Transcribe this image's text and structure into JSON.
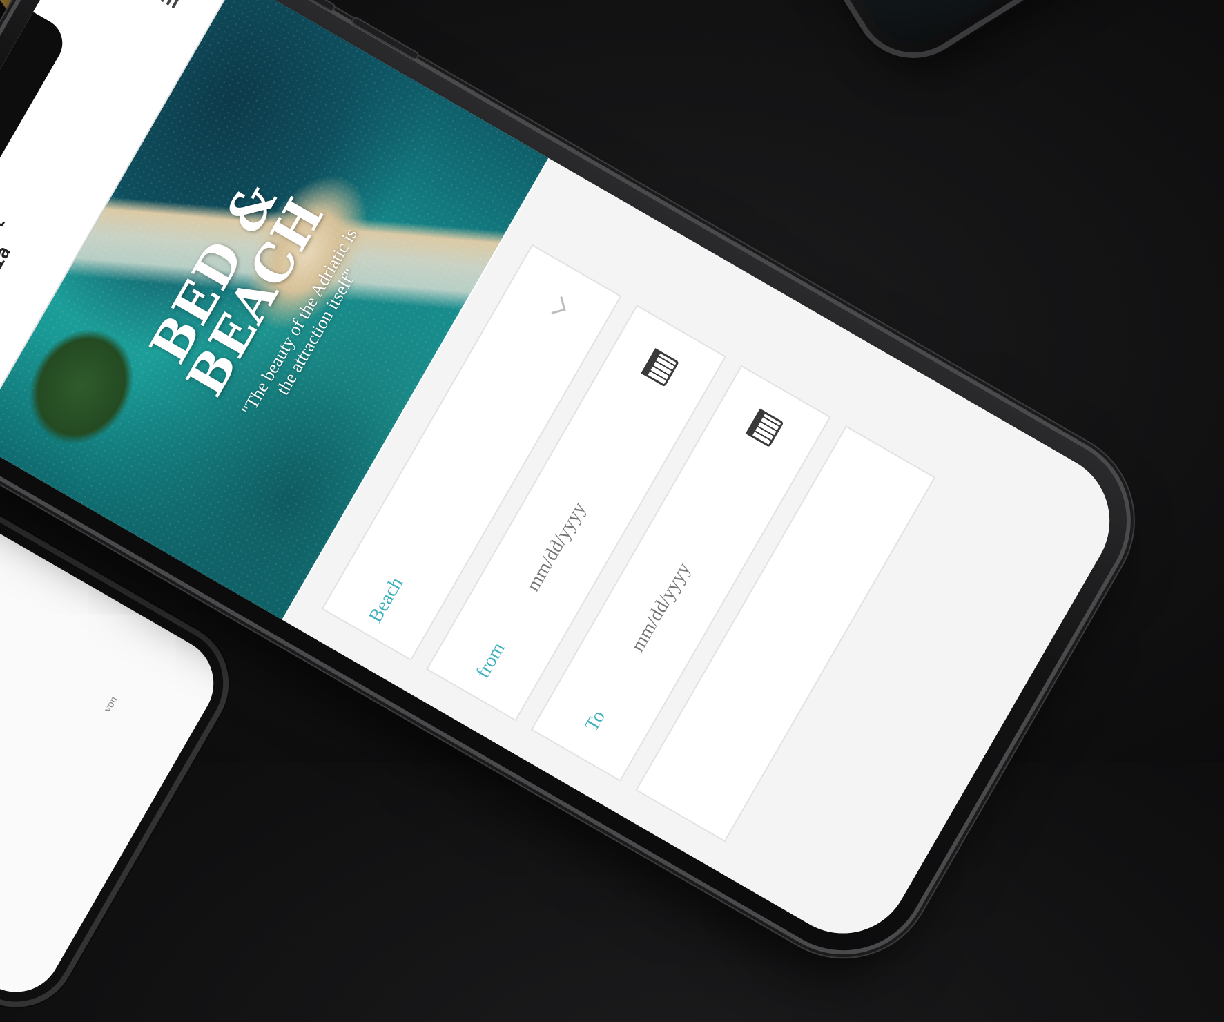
{
  "background_phone_snippet": "von",
  "site": {
    "logo_line1": "Bed & Breakfast",
    "logo_line2": "Croatia",
    "menu_icon": "hamburger-menu-icon"
  },
  "hero": {
    "title_line1": "BED &",
    "title_line2": "BEACH",
    "quote_line1": "\"The beauty of the Adriatic is",
    "quote_line2": "the attraction itself\""
  },
  "search": {
    "destination_label": "Beach",
    "from_label": "from",
    "from_placeholder": "mm/dd/yyyy",
    "to_label": "To",
    "to_placeholder": "mm/dd/yyyy"
  },
  "colors": {
    "accent": "#3fb0bd",
    "background": "#111112"
  }
}
